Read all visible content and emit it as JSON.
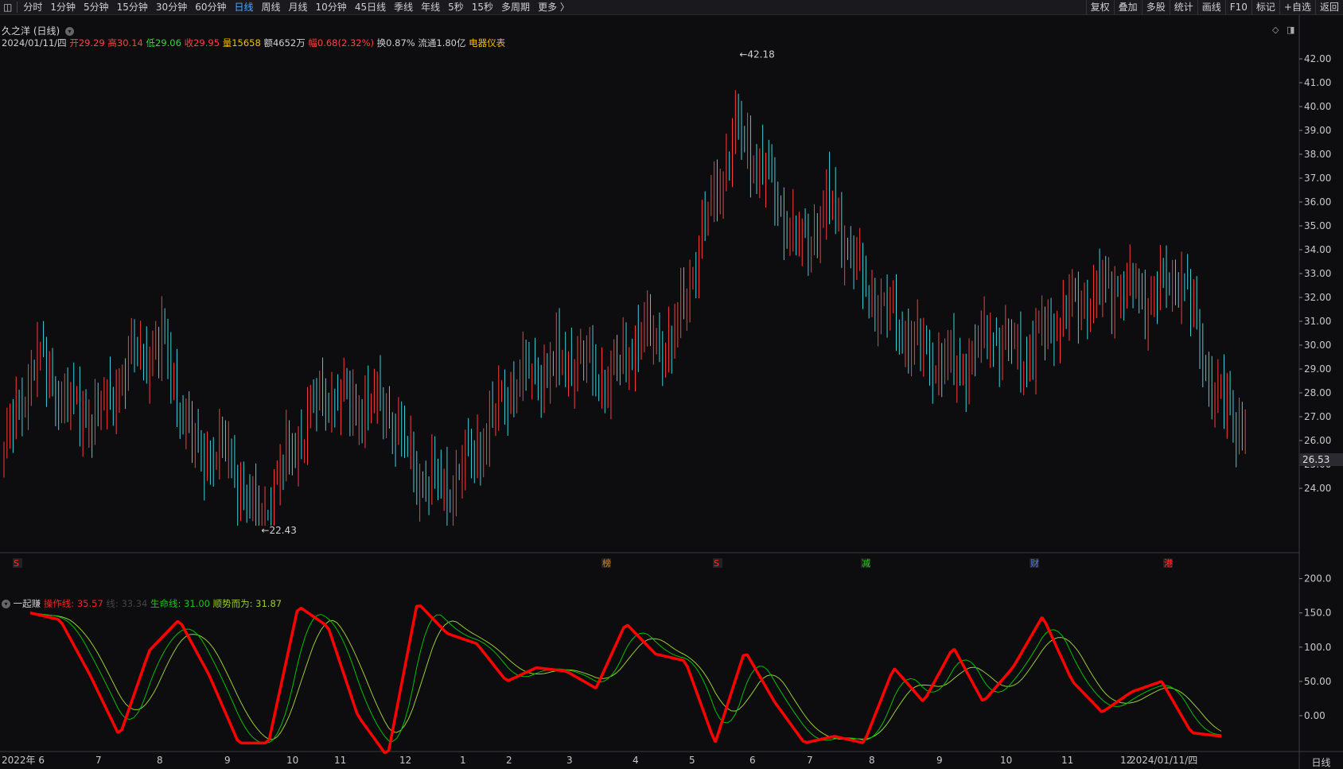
{
  "toolbar": {
    "items": [
      "分时",
      "1分钟",
      "5分钟",
      "15分钟",
      "30分钟",
      "60分钟",
      "日线",
      "周线",
      "月线",
      "10分钟",
      "45日线",
      "季线",
      "年线",
      "5秒",
      "15秒",
      "多周期",
      "更多 〉"
    ],
    "active_index": 6,
    "right_items": [
      "复权",
      "叠加",
      "多股",
      "统计",
      "画线",
      "F10",
      "标记",
      "+自选",
      "返回"
    ]
  },
  "stock": {
    "title": "久之洋 (日线)",
    "date": "2024/01/11/四",
    "open": "开29.29",
    "high": "高30.14",
    "low": "低29.06",
    "close": "收29.95",
    "volume": "量15658",
    "amount": "额4652万",
    "change": "幅0.68(2.32%)",
    "turnover": "换0.87%",
    "float": "流通1.80亿",
    "industry": "电器仪表"
  },
  "indicator": {
    "name": "一起赚",
    "op_line": "操作线: 35.57",
    "hidden": "线: 33.34",
    "life_line": "生命线: 31.00",
    "trend": "顺势而为: 31.87"
  },
  "price_axis": [
    "42.00",
    "41.00",
    "40.00",
    "39.00",
    "38.00",
    "37.00",
    "36.00",
    "35.00",
    "34.00",
    "33.00",
    "32.00",
    "31.00",
    "30.00",
    "29.00",
    "28.00",
    "27.00",
    "26.00",
    "25.00",
    "24.00"
  ],
  "ind_axis": [
    "200.0",
    "150.0",
    "100.0",
    "50.00",
    "0.00"
  ],
  "current_price": "26.53",
  "max_label": "42.18",
  "min_label": "22.43",
  "time_axis": [
    "2022年 6",
    "7",
    "8",
    "9",
    "10",
    "11",
    "12",
    "1",
    "2",
    "3",
    "4",
    "5",
    "6",
    "7",
    "8",
    "9",
    "10",
    "11",
    "12",
    "2024/01/11/四"
  ],
  "period_label": "日线",
  "event_markers": [
    "S",
    "榜",
    "S",
    "减",
    "财",
    "港"
  ],
  "colors": {
    "up": "#ff3b3b",
    "down": "#3fd0d8",
    "op_line": "#ff0000",
    "life_line": "#00c000",
    "trend_line": "#9acd32",
    "bg": "#0d0d0f"
  },
  "chart_data": {
    "type": "candlestick",
    "title": "久之洋 (日线)",
    "ylim": [
      22.0,
      42.5
    ],
    "x_label_range": [
      "2022年 6",
      "2024/01/11/四"
    ],
    "keypoints_close": [
      {
        "x": "2022-06",
        "y": 25.5
      },
      {
        "x": "2022-06",
        "y": 29.5
      },
      {
        "x": "2022-07",
        "y": 27.5
      },
      {
        "x": "2022-07",
        "y": 27.0
      },
      {
        "x": "2022-08",
        "y": 29.5
      },
      {
        "x": "2022-08",
        "y": 30.0
      },
      {
        "x": "2022-09",
        "y": 25.5
      },
      {
        "x": "2022-09",
        "y": 25.5
      },
      {
        "x": "2022-10",
        "y": 22.5
      },
      {
        "x": "2022-10",
        "y": 25.5
      },
      {
        "x": "2022-11",
        "y": 28.0
      },
      {
        "x": "2022-11",
        "y": 27.5
      },
      {
        "x": "2022-12",
        "y": 27.5
      },
      {
        "x": "2022-12",
        "y": 24.5
      },
      {
        "x": "2023-01",
        "y": 24.0
      },
      {
        "x": "2023-01",
        "y": 26.0
      },
      {
        "x": "2023-02",
        "y": 28.5
      },
      {
        "x": "2023-02",
        "y": 29.0
      },
      {
        "x": "2023-03",
        "y": 29.5
      },
      {
        "x": "2023-03",
        "y": 28.5
      },
      {
        "x": "2023-04",
        "y": 30.5
      },
      {
        "x": "2023-04",
        "y": 30.0
      },
      {
        "x": "2023-05",
        "y": 35.0
      },
      {
        "x": "2023-05",
        "y": 39.0
      },
      {
        "x": "2023-06",
        "y": 37.0
      },
      {
        "x": "2023-06",
        "y": 34.0
      },
      {
        "x": "2023-07",
        "y": 36.0
      },
      {
        "x": "2023-07",
        "y": 32.5
      },
      {
        "x": "2023-08",
        "y": 31.0
      },
      {
        "x": "2023-08",
        "y": 29.5
      },
      {
        "x": "2023-09",
        "y": 29.0
      },
      {
        "x": "2023-09",
        "y": 30.5
      },
      {
        "x": "2023-10",
        "y": 29.5
      },
      {
        "x": "2023-10",
        "y": 31.0
      },
      {
        "x": "2023-11",
        "y": 32.0
      },
      {
        "x": "2023-11",
        "y": 32.5
      },
      {
        "x": "2023-12",
        "y": 32.0
      },
      {
        "x": "2023-12",
        "y": 33.0
      },
      {
        "x": "2024-01",
        "y": 28.0
      },
      {
        "x": "2024-01-11",
        "y": 26.53
      }
    ],
    "indicator": {
      "ylim": [
        -50,
        210
      ],
      "series": [
        {
          "name": "操作线",
          "values": [
            150,
            140,
            60,
            -30,
            95,
            140,
            60,
            -40,
            -40,
            160,
            130,
            0,
            -60,
            165,
            120,
            105,
            50,
            70,
            65,
            40,
            135,
            90,
            80,
            -40,
            95,
            20,
            -40,
            -30,
            -40,
            70,
            20,
            100,
            20,
            70,
            145,
            50,
            5,
            35,
            50,
            -25,
            -30
          ]
        }
      ]
    }
  }
}
